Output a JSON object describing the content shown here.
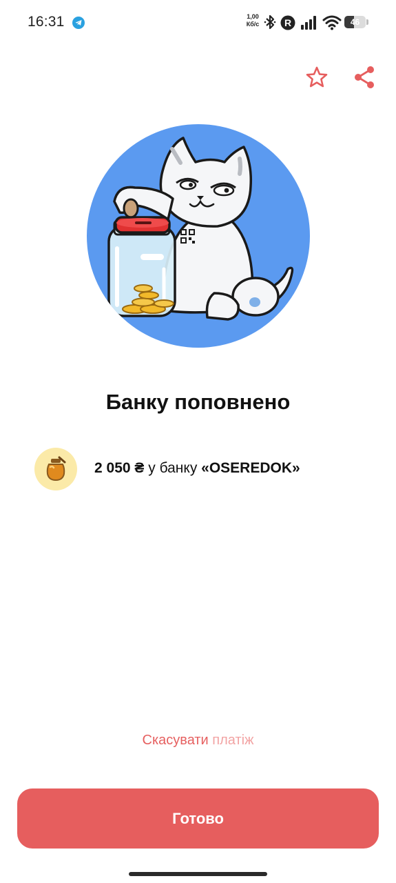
{
  "status_bar": {
    "time": "16:31",
    "speed_value": "1,00",
    "speed_unit": "Кб/с",
    "battery": "46",
    "battery_level": 0.46
  },
  "actions": {
    "favorite_icon": "star-icon",
    "share_icon": "share-icon"
  },
  "colors": {
    "accent": "#e65e5e",
    "hero_bg": "#5b9af0",
    "badge_bg": "#fbeaa8"
  },
  "title": "Банку поповнено",
  "transfer": {
    "amount": "2 050 ₴",
    "middle": " у банку ",
    "bank_name": "«OSEREDOK»"
  },
  "cancel": {
    "part1": "Скасувати",
    "part2": " платіж"
  },
  "done_button": "Готово"
}
